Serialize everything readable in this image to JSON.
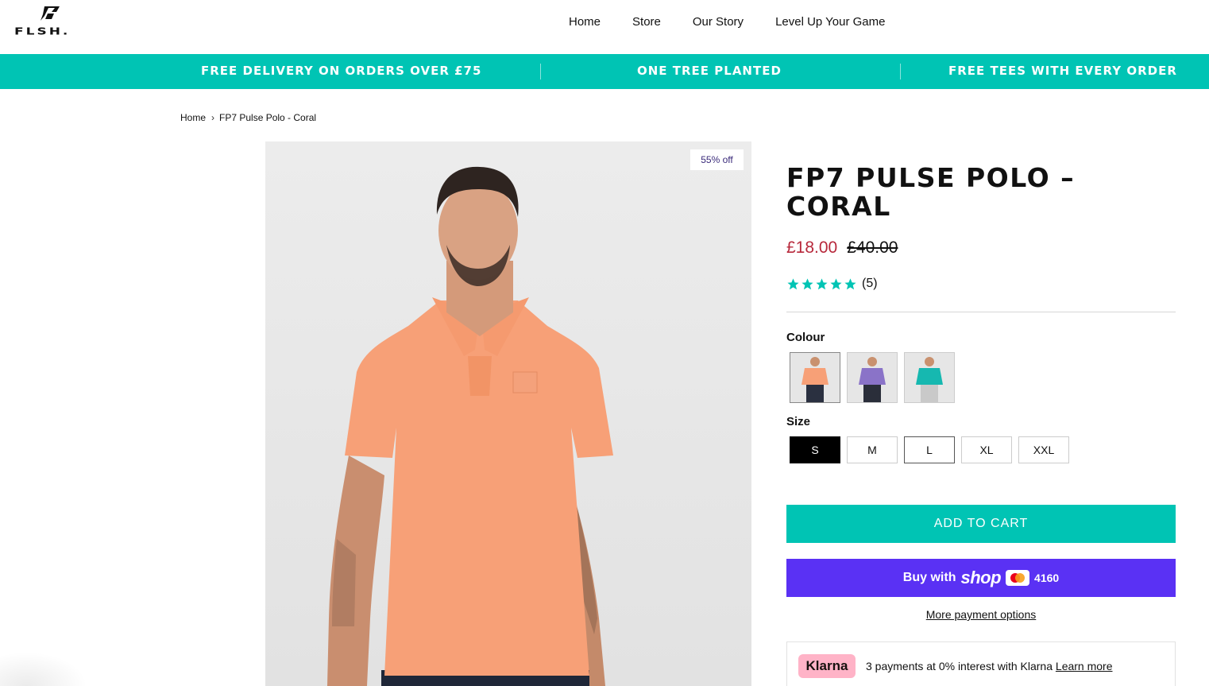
{
  "header": {
    "logo_text": "FLSH.",
    "nav": [
      "Home",
      "Store",
      "Our Story",
      "Level Up Your Game"
    ]
  },
  "announcement": {
    "items": [
      "FREE DELIVERY ON ORDERS OVER £75",
      "ONE TREE PLANTED",
      "FREE TEES WITH EVERY ORDER"
    ]
  },
  "breadcrumb": {
    "home": "Home",
    "current": "FP7 Pulse Polo - Coral"
  },
  "product": {
    "discount_badge": "55% off",
    "title": "FP7 PULSE POLO – CORAL",
    "price_now": "£18.00",
    "price_was": "£40.00",
    "rating": 5,
    "rating_count": "(5)",
    "colour_label": "Colour",
    "colours": [
      {
        "name": "Coral",
        "shirt": "#f7a077",
        "trousers": "#2a3040"
      },
      {
        "name": "Purple",
        "shirt": "#8a73c8",
        "trousers": "#2a2e3a"
      },
      {
        "name": "Teal",
        "shirt": "#16b8b0",
        "trousers": "#c9c9c9"
      }
    ],
    "size_label": "Size",
    "sizes": [
      "S",
      "M",
      "L",
      "XL",
      "XXL"
    ],
    "selected_size": "S"
  },
  "actions": {
    "add_to_cart": "ADD TO CART",
    "buy_with": "Buy with",
    "shop_word": "shop",
    "card_last4": "4160",
    "more_payment": "More payment options"
  },
  "klarna": {
    "logo": "Klarna",
    "text": "3 payments at 0% interest with Klarna",
    "learn_more": "Learn more"
  },
  "colors": {
    "accent": "#00c4b4",
    "sale_price": "#b7283b",
    "shop_pay": "#5a31f4",
    "klarna_pink": "#ffb3c7",
    "star": "#00c4b4"
  }
}
